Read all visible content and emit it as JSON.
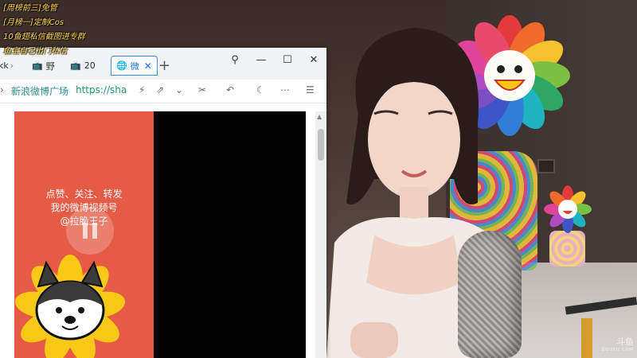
{
  "overlay": {
    "lines": [
      "[周榜前三]免管",
      "[月榜一]定制Cos",
      "10鱼翅私信截图进专群",
      "鱼宝自己出门私信"
    ]
  },
  "browser": {
    "tabs": [
      {
        "label": "kk",
        "icon": "app-icon"
      },
      {
        "label": "野",
        "icon": "bilibili-icon"
      },
      {
        "label": "20",
        "icon": "bilibili-icon"
      },
      {
        "label": "微",
        "icon": "globe-icon",
        "active": true
      }
    ],
    "new_tab": "+",
    "window_controls": {
      "pin": "⚲",
      "minimize": "—",
      "maximize": "☐",
      "close": "✕"
    },
    "toolbar": {
      "weibo_link": "新浪微博广场",
      "url": "https://sha",
      "menu": "⋯"
    },
    "video": {
      "caption_lines": [
        "点赞、关注、转发",
        "我的微博视频号",
        "@拉脆王子"
      ]
    }
  },
  "watermark": {
    "main": "斗鱼",
    "sub": "DOUYU.COM"
  },
  "colors": {
    "overlay_text": "#ffd54a",
    "active_tab": "#1a73e8",
    "video_panel": "#e65b45",
    "url_text": "#209a6c"
  }
}
